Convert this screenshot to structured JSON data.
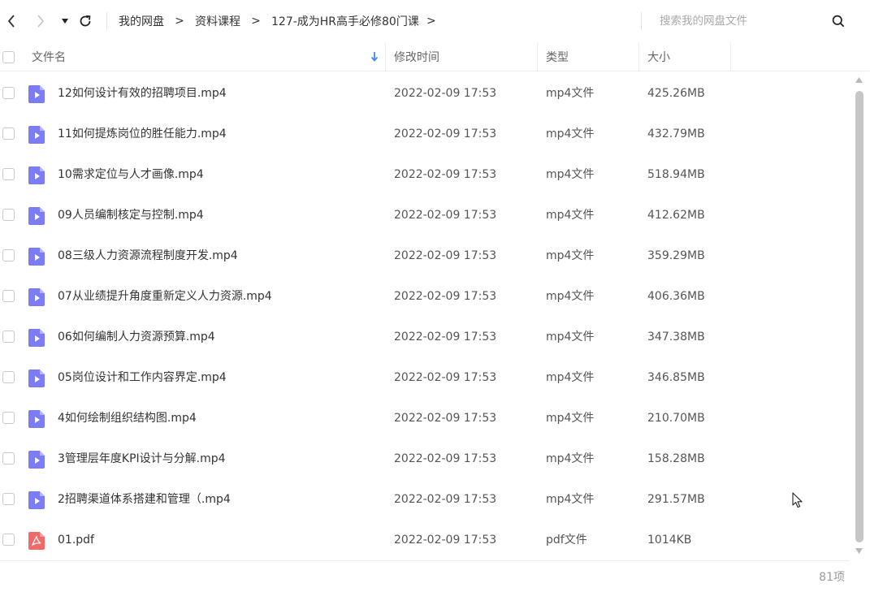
{
  "breadcrumb": {
    "items": [
      "我的网盘",
      "资料课程",
      "127-成为HR高手必修80门课"
    ],
    "separator": ">"
  },
  "search": {
    "placeholder": "搜索我的网盘文件"
  },
  "icons": {
    "back": "chevron-left-icon",
    "forward": "chevron-right-icon",
    "history": "dropdown-triangle-icon",
    "refresh": "refresh-icon",
    "search": "search-icon",
    "sort": "sort-arrow-down-icon",
    "video_file": "video-file-icon",
    "pdf_file": "pdf-file-icon"
  },
  "columns": {
    "name": "文件名",
    "modified": "修改时间",
    "type": "类型",
    "size": "大小"
  },
  "colors": {
    "video_icon": "#7b7cf6",
    "pdf_icon": "#f06a6a",
    "sort_arrow": "#3b8cf3",
    "scrollbar_thumb": "#c6c6c6"
  },
  "files": [
    {
      "name": "12如何设计有效的招聘项目.mp4",
      "date": "2022-02-09 17:53",
      "type": "mp4文件",
      "size": "425.26MB",
      "kind": "video"
    },
    {
      "name": "11如何提炼岗位的胜任能力.mp4",
      "date": "2022-02-09 17:53",
      "type": "mp4文件",
      "size": "432.79MB",
      "kind": "video"
    },
    {
      "name": "10需求定位与人才画像.mp4",
      "date": "2022-02-09 17:53",
      "type": "mp4文件",
      "size": "518.94MB",
      "kind": "video"
    },
    {
      "name": "09人员编制核定与控制.mp4",
      "date": "2022-02-09 17:53",
      "type": "mp4文件",
      "size": "412.62MB",
      "kind": "video"
    },
    {
      "name": "08三级人力资源流程制度开发.mp4",
      "date": "2022-02-09 17:53",
      "type": "mp4文件",
      "size": "359.29MB",
      "kind": "video"
    },
    {
      "name": "07从业绩提升角度重新定义人力资源.mp4",
      "date": "2022-02-09 17:53",
      "type": "mp4文件",
      "size": "406.36MB",
      "kind": "video"
    },
    {
      "name": "06如何编制人力资源预算.mp4",
      "date": "2022-02-09 17:53",
      "type": "mp4文件",
      "size": "347.38MB",
      "kind": "video"
    },
    {
      "name": "05岗位设计和工作内容界定.mp4",
      "date": "2022-02-09 17:53",
      "type": "mp4文件",
      "size": "346.85MB",
      "kind": "video"
    },
    {
      "name": "4如何绘制组织结构图.mp4",
      "date": "2022-02-09 17:53",
      "type": "mp4文件",
      "size": "210.70MB",
      "kind": "video"
    },
    {
      "name": "3管理层年度KPI设计与分解.mp4",
      "date": "2022-02-09 17:53",
      "type": "mp4文件",
      "size": "158.28MB",
      "kind": "video"
    },
    {
      "name": "2招聘渠道体系搭建和管理（.mp4",
      "date": "2022-02-09 17:53",
      "type": "mp4文件",
      "size": "291.57MB",
      "kind": "video"
    },
    {
      "name": "01.pdf",
      "date": "2022-02-09 17:53",
      "type": "pdf文件",
      "size": "1014KB",
      "kind": "pdf"
    }
  ],
  "footer": {
    "count": "81项"
  }
}
